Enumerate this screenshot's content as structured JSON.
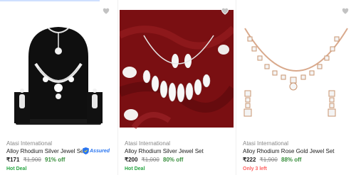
{
  "products": [
    {
      "brand": "Atasi International",
      "title": "Alloy Rhodium Silver Jewel Set",
      "price": "₹171",
      "mrp": "₹1,900",
      "discount": "91% off",
      "tag": "Hot Deal",
      "assured_label": "Assured"
    },
    {
      "brand": "Atasi International",
      "title": "Alloy Rhodium Silver Jewel Set",
      "price": "₹200",
      "mrp": "₹1,000",
      "discount": "80% off",
      "tag": "Hot Deal"
    },
    {
      "brand": "Atasi International",
      "title": "Alloy Rhodium Rose Gold Jewel Set",
      "price": "₹222",
      "mrp": "₹1,900",
      "discount": "88% off",
      "stock_note": "Only 3 left"
    }
  ],
  "icons": {
    "wishlist": "heart-icon",
    "assured": "assured-shield-icon"
  },
  "colors": {
    "price_off": "#388e3c",
    "hot_deal": "#26a541",
    "low_stock": "#ff6161",
    "assured": "#2874f0",
    "velvet": "#7a0f12"
  }
}
